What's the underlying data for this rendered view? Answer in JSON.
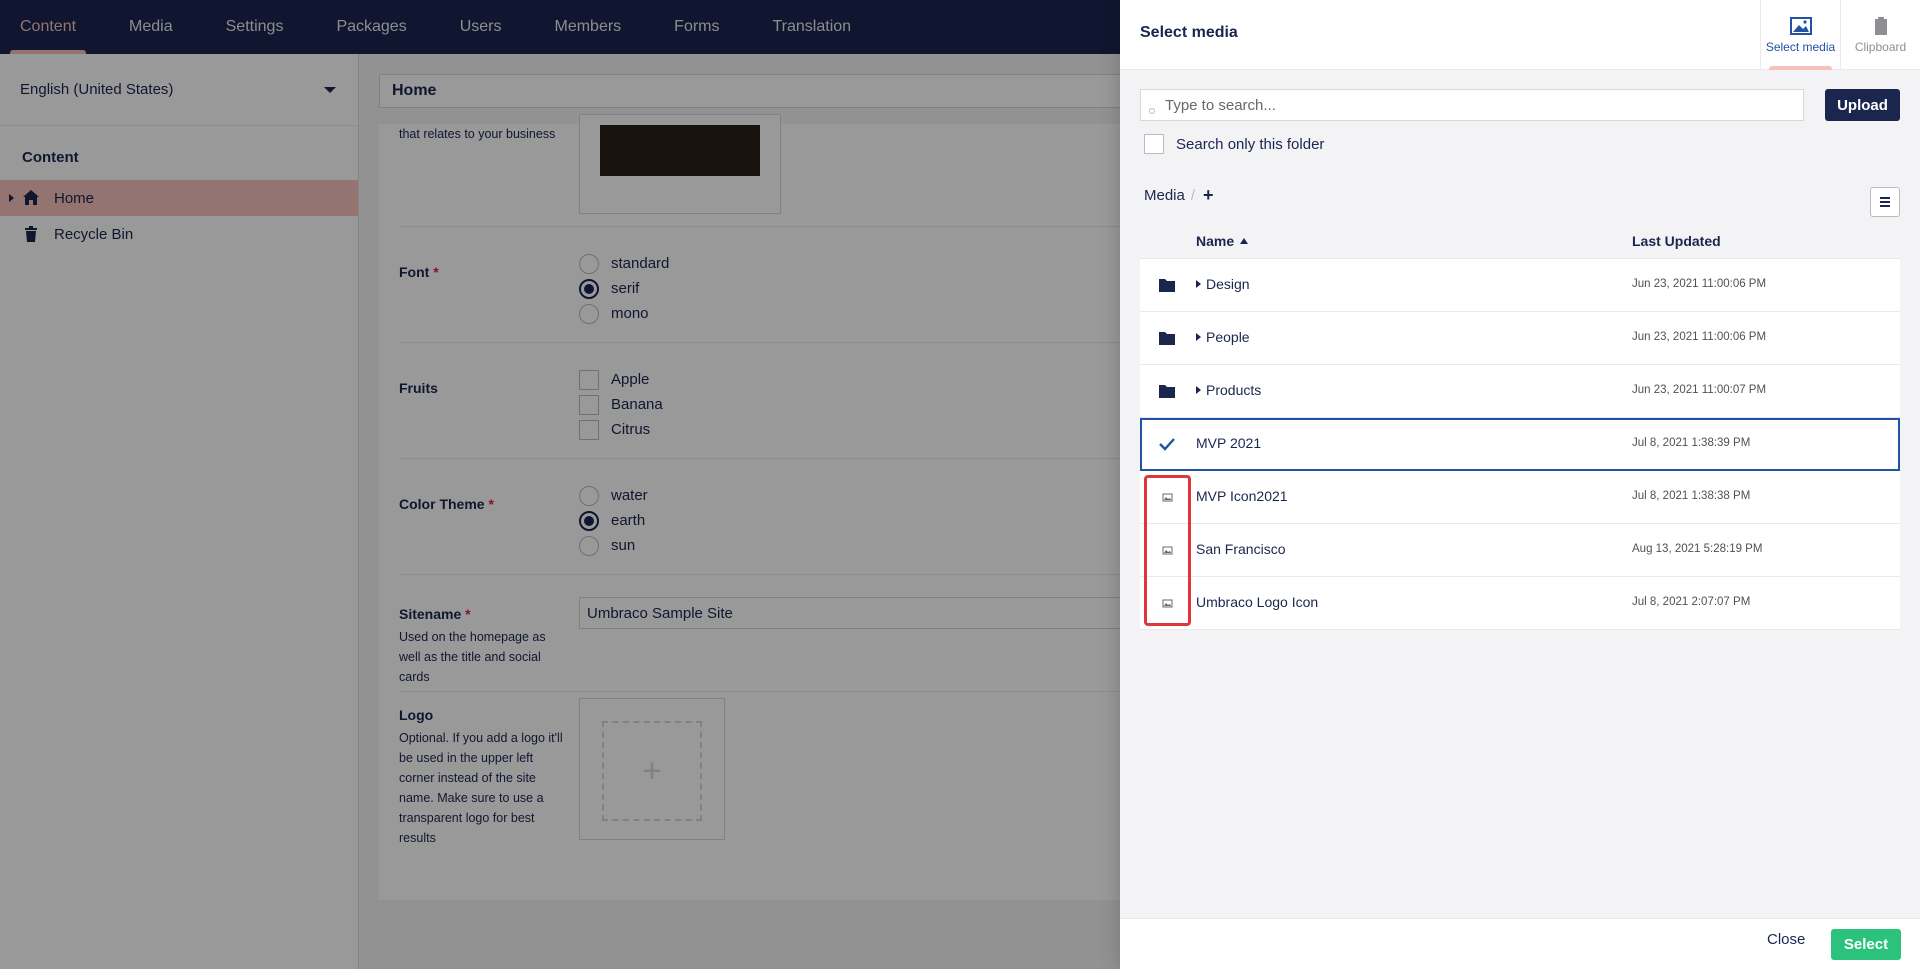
{
  "nav": {
    "tabs": [
      "Content",
      "Media",
      "Settings",
      "Packages",
      "Users",
      "Members",
      "Forms",
      "Translation"
    ]
  },
  "tree": {
    "language": "English (United States)",
    "title": "Content",
    "items": [
      {
        "label": "Home",
        "icon": "home-icon"
      },
      {
        "label": "Recycle Bin",
        "icon": "trash-icon"
      }
    ]
  },
  "editor": {
    "node_name": "Home",
    "top_desc": "that relates to your business",
    "font": {
      "label": "Font",
      "options": [
        "standard",
        "serif",
        "mono"
      ],
      "selected": "serif"
    },
    "fruits": {
      "label": "Fruits",
      "options": [
        "Apple",
        "Banana",
        "Citrus"
      ]
    },
    "color_theme": {
      "label": "Color Theme",
      "options": [
        "water",
        "earth",
        "sun"
      ],
      "selected": "earth"
    },
    "sitename": {
      "label": "Sitename",
      "desc": "Used on the homepage as well as the title and social cards",
      "value": "Umbraco Sample Site"
    },
    "logo": {
      "label": "Logo",
      "desc": "Optional. If you add a logo it'll be used in the upper left corner instead of the site name. Make sure to use a transparent logo for best results"
    },
    "required_mark": "*"
  },
  "overlay": {
    "title": "Select media",
    "tabs": [
      {
        "label": "Select media",
        "icon": "picture-icon"
      },
      {
        "label": "Clipboard",
        "icon": "clipboard-icon"
      }
    ],
    "search_placeholder": "Type to search...",
    "upload": "Upload",
    "only_folder": "Search only this folder",
    "breadcrumb": {
      "root": "Media",
      "sep": "/",
      "add": "+"
    },
    "columns": {
      "name": "Name",
      "updated": "Last Updated"
    },
    "rows": [
      {
        "name": "Design",
        "updated": "Jun 23, 2021 11:00:06 PM",
        "type": "folder"
      },
      {
        "name": "People",
        "updated": "Jun 23, 2021 11:00:06 PM",
        "type": "folder"
      },
      {
        "name": "Products",
        "updated": "Jun 23, 2021 11:00:07 PM",
        "type": "folder"
      },
      {
        "name": "MVP 2021",
        "updated": "Jul 8, 2021 1:38:39 PM",
        "type": "selected"
      },
      {
        "name": "MVP Icon2021",
        "updated": "Jul 8, 2021 1:38:38 PM",
        "type": "image"
      },
      {
        "name": "San Francisco",
        "updated": "Aug 13, 2021 5:28:19 PM",
        "type": "image"
      },
      {
        "name": "Umbraco Logo Icon",
        "updated": "Jul 8, 2021 2:07:07 PM",
        "type": "image"
      }
    ],
    "close": "Close",
    "select": "Select"
  },
  "colors": {
    "navy": "#1b264f",
    "pink": "#f5c1bc",
    "green": "#2bc37c",
    "highlight": "#e0363a"
  }
}
